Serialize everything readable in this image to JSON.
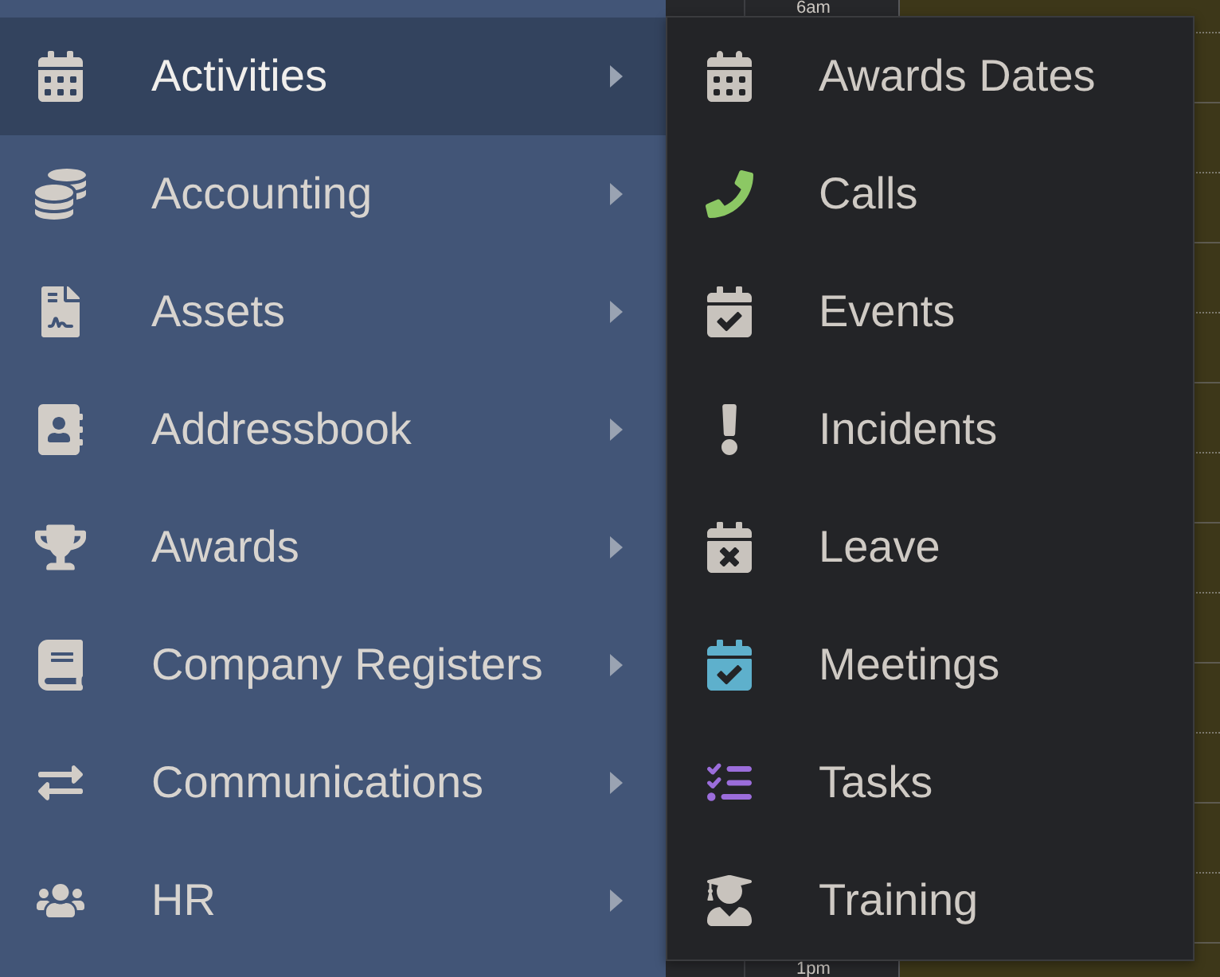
{
  "calendar": {
    "time_labels": [
      "6am",
      "1pm"
    ]
  },
  "sidebar": {
    "items": [
      {
        "label": "Activities",
        "selected": true
      },
      {
        "label": "Accounting",
        "selected": false
      },
      {
        "label": "Assets",
        "selected": false
      },
      {
        "label": "Addressbook",
        "selected": false
      },
      {
        "label": "Awards",
        "selected": false
      },
      {
        "label": "Company Registers",
        "selected": false
      },
      {
        "label": "Communications",
        "selected": false
      },
      {
        "label": "HR",
        "selected": false
      }
    ]
  },
  "submenu": {
    "items": [
      {
        "label": "Awards Dates",
        "color": "#c8c3bd"
      },
      {
        "label": "Calls",
        "color": "#8cc864"
      },
      {
        "label": "Events",
        "color": "#c8c3bd"
      },
      {
        "label": "Incidents",
        "color": "#c8c3bd"
      },
      {
        "label": "Leave",
        "color": "#c8c3bd"
      },
      {
        "label": "Meetings",
        "color": "#5eb0cc"
      },
      {
        "label": "Tasks",
        "color": "#9b6ddb"
      },
      {
        "label": "Training",
        "color": "#c8c3bd"
      }
    ]
  }
}
